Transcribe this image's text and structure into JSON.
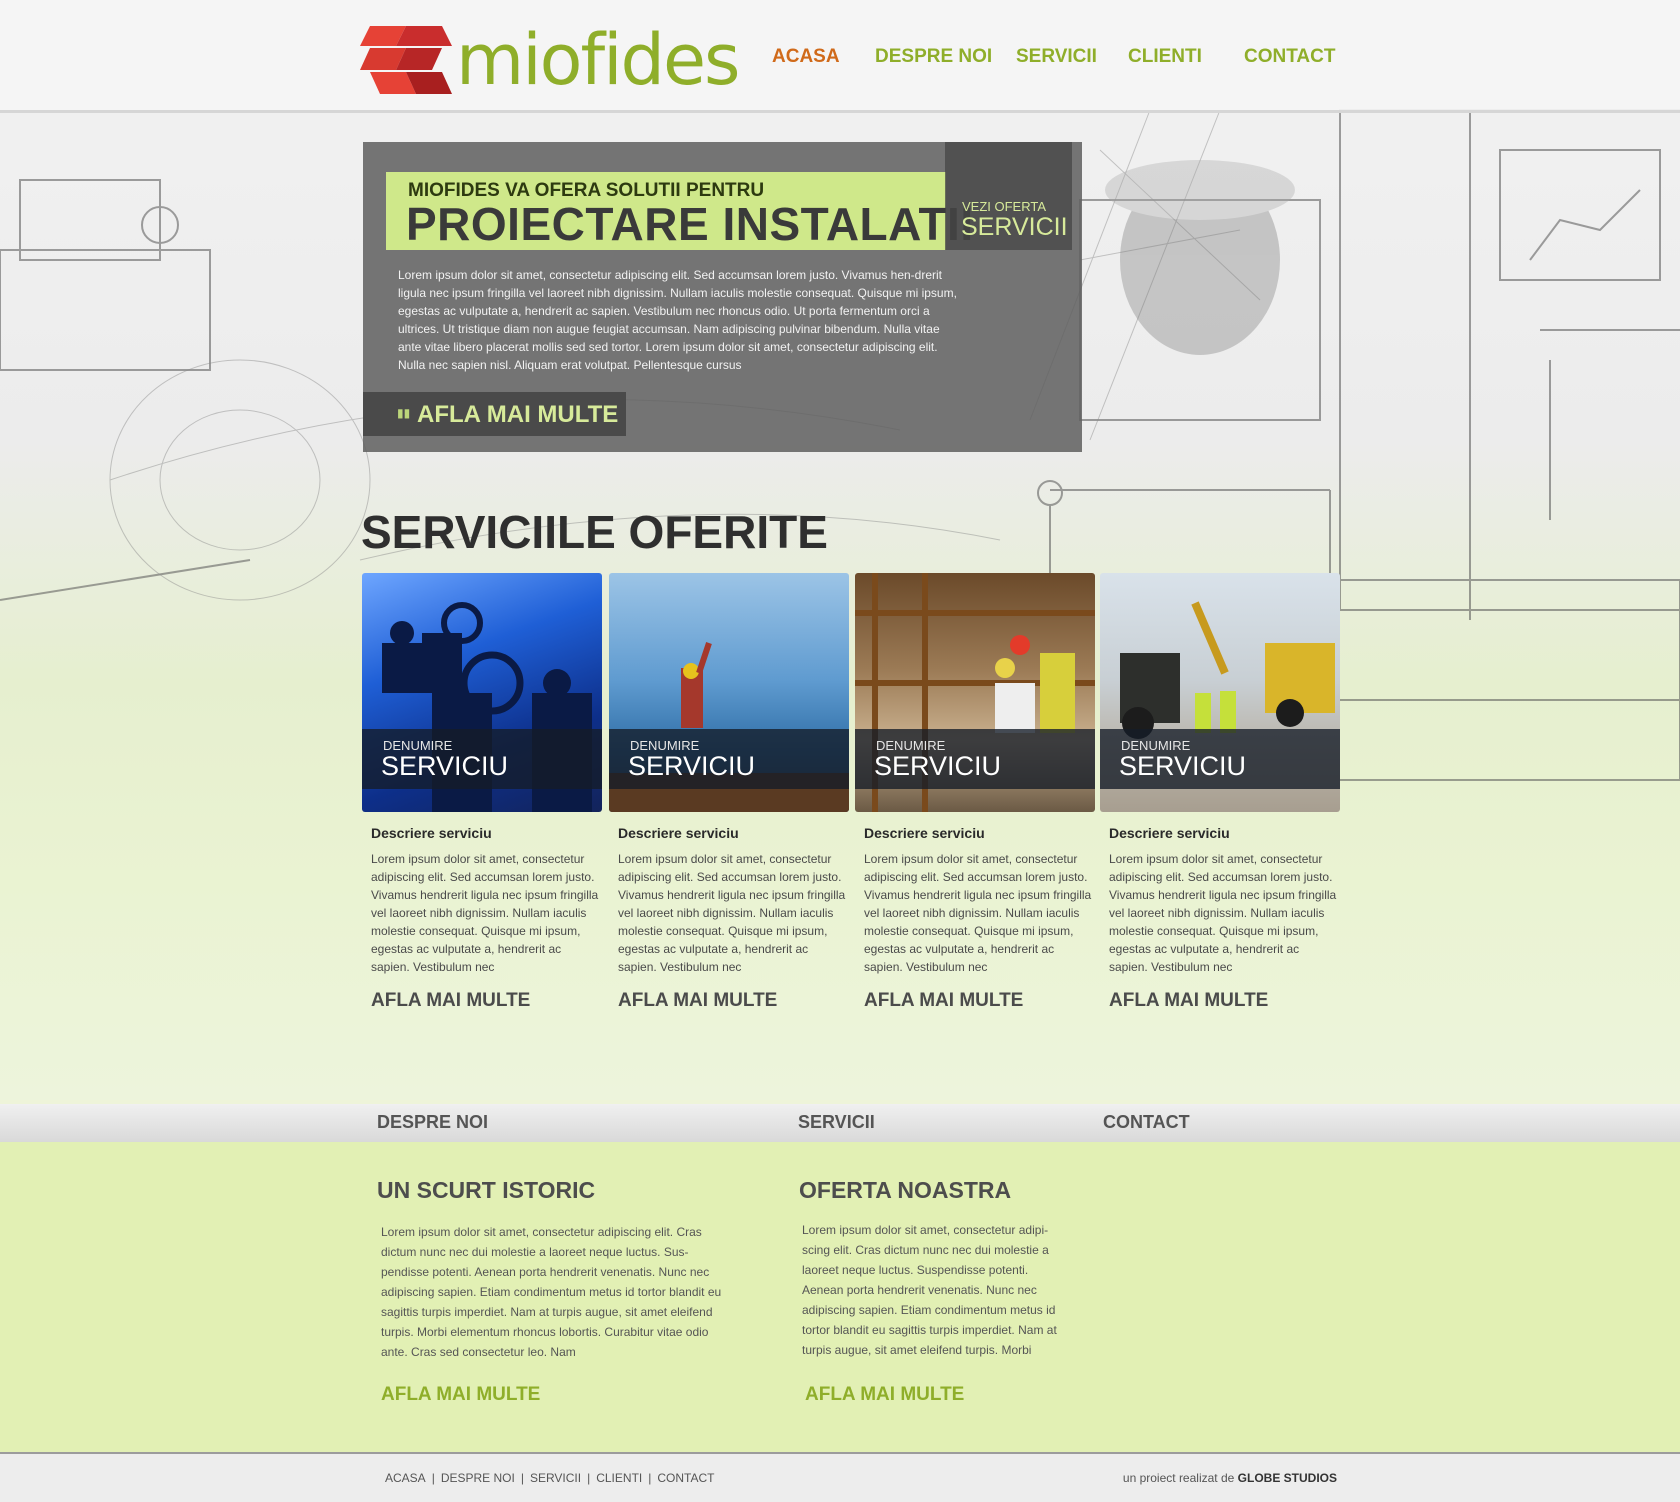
{
  "header": {
    "logo_text": "miofides",
    "nav": [
      {
        "label": "ACASA",
        "active": true
      },
      {
        "label": "DESPRE NOI",
        "active": false
      },
      {
        "label": "SERVICII",
        "active": false
      },
      {
        "label": "CLIENTI",
        "active": false
      },
      {
        "label": "CONTACT",
        "active": false
      }
    ]
  },
  "hero": {
    "kicker": "MIOFIDES VA OFERA SOLUTII PENTRU",
    "title": "PROIECTARE INSTALATII",
    "offer_kicker": "VEZI OFERTA",
    "offer_main": "SERVICII",
    "text": "Lorem ipsum dolor sit amet, consectetur adipiscing elit. Sed accumsan lorem justo. Vivamus hen-drerit ligula nec ipsum fringilla vel laoreet nibh dignissim. Nullam iaculis molestie consequat. Quisque mi ipsum, egestas ac vulputate a, hendrerit ac sapien. Vestibulum nec rhoncus odio. Ut porta fermentum orci a ultrices. Ut tristique diam non augue feugiat accumsan. Nam adipiscing pulvinar bibendum. Nulla vitae ante vitae libero placerat mollis sed sed tortor. Lorem ipsum dolor sit amet, consectetur adipiscing elit. Nulla nec sapien nisl. Aliquam erat volutpat. Pellentesque cursus",
    "button_label": "AFLA MAI MULTE"
  },
  "services": {
    "title": "SERVICIILE OFERITE",
    "cards": [
      {
        "ov_kicker": "DENUMIRE",
        "ov_main": "SERVICIU",
        "desc_title": "Descriere serviciu",
        "desc": "Lorem ipsum dolor sit amet, consectetur adipiscing elit. Sed accumsan lorem justo. Vivamus hendrerit ligula nec ipsum fringilla vel laoreet nibh dignissim. Nullam iaculis molestie consequat. Quisque mi ipsum, egestas ac vulputate a, hendrerit ac sapien. Vestibulum nec",
        "link": "AFLA MAI MULTE"
      },
      {
        "ov_kicker": "DENUMIRE",
        "ov_main": "SERVICIU",
        "desc_title": "Descriere serviciu",
        "desc": "Lorem ipsum dolor sit amet, consectetur adipiscing elit. Sed accumsan lorem justo. Vivamus hendrerit ligula nec ipsum fringilla vel laoreet nibh dignissim. Nullam iaculis molestie consequat. Quisque mi ipsum, egestas ac vulputate a, hendrerit ac sapien. Vestibulum nec",
        "link": "AFLA MAI MULTE"
      },
      {
        "ov_kicker": "DENUMIRE",
        "ov_main": "SERVICIU",
        "desc_title": "Descriere serviciu",
        "desc": "Lorem ipsum dolor sit amet, consectetur adipiscing elit. Sed accumsan lorem justo. Vivamus hendrerit ligula nec ipsum fringilla vel laoreet nibh dignissim. Nullam iaculis molestie consequat. Quisque mi ipsum, egestas ac vulputate a, hendrerit ac sapien. Vestibulum nec",
        "link": "AFLA MAI MULTE"
      },
      {
        "ov_kicker": "DENUMIRE",
        "ov_main": "SERVICIU",
        "desc_title": "Descriere serviciu",
        "desc": "Lorem ipsum dolor sit amet, consectetur adipiscing elit. Sed accumsan lorem justo. Vivamus hendrerit ligula nec ipsum fringilla vel laoreet nibh dignissim. Nullam iaculis molestie consequat. Quisque mi ipsum, egestas ac vulputate a, hendrerit ac sapien. Vestibulum nec",
        "link": "AFLA MAI MULTE"
      }
    ]
  },
  "tabs": [
    "DESPRE NOI",
    "SERVICII",
    "CONTACT"
  ],
  "columns": [
    {
      "title": "UN SCURT ISTORIC",
      "text": "Lorem ipsum dolor sit amet, consectetur adipiscing elit. Cras dictum nunc nec dui molestie a laoreet neque luctus. Sus-pendisse potenti. Aenean porta hendrerit venenatis. Nunc nec adipiscing sapien. Etiam condimentum metus id tortor blandit eu sagittis turpis imperdiet. Nam at turpis augue, sit amet eleifend turpis. Morbi elementum rhoncus lobortis. Curabitur vitae odio ante. Cras sed consectetur leo. Nam",
      "link": "AFLA MAI MULTE"
    },
    {
      "title": "OFERTA NOASTRA",
      "text": "Lorem ipsum dolor sit amet, consectetur adipi-scing elit. Cras dictum nunc nec dui molestie a laoreet neque luctus. Suspendisse potenti. Aenean porta hendrerit venenatis. Nunc nec adipiscing sapien. Etiam condimentum metus id tortor blandit eu sagittis turpis imperdiet. Nam at turpis augue, sit amet eleifend turpis. Morbi",
      "link": "AFLA MAI MULTE"
    }
  ],
  "footer": {
    "links": [
      "ACASA",
      "DESPRE NOI",
      "SERVICII",
      "CLIENTI",
      "CONTACT"
    ],
    "separator": "|",
    "credit_prefix": "un proiect realizat de",
    "credit_name": "GLOBE STUDIOS"
  },
  "colors": {
    "brand_green": "#8fae2a",
    "active_orange": "#d06a1a",
    "hero_title_bg": "#cfe88a",
    "lower_bg": "#e2f0b4"
  }
}
